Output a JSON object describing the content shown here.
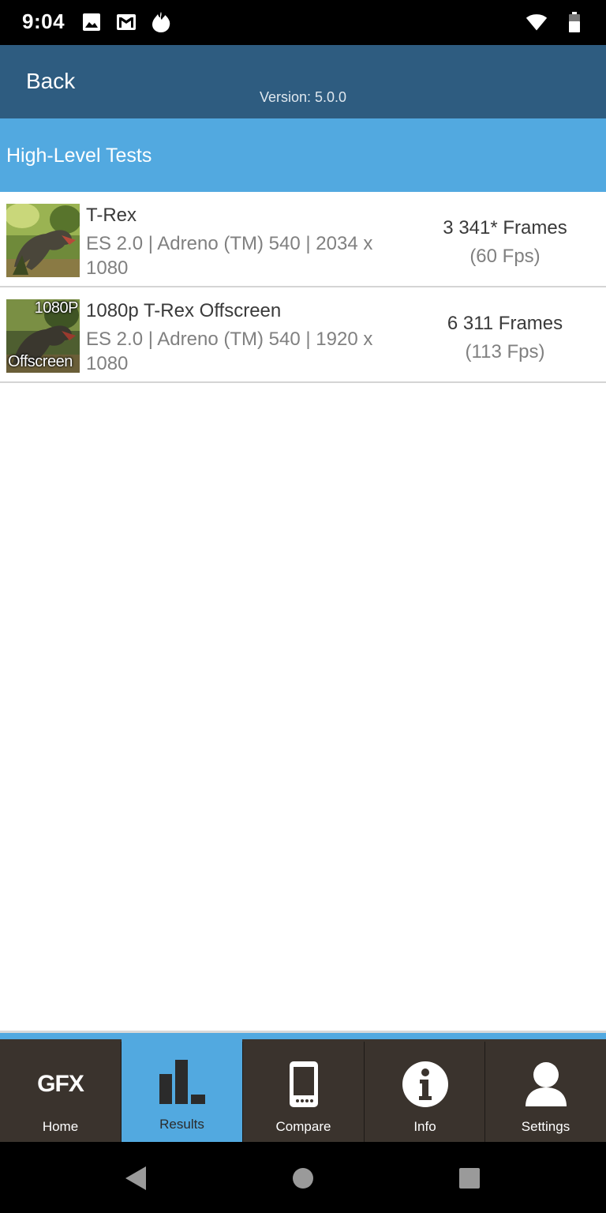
{
  "status_bar": {
    "time": "9:04",
    "left_icons": [
      "image-icon",
      "gmail-icon",
      "fire-icon"
    ],
    "right_icons": [
      "wifi-icon",
      "battery-icon"
    ]
  },
  "app_bar": {
    "back_label": "Back",
    "version": "Version: 5.0.0"
  },
  "section": {
    "title": "High-Level Tests"
  },
  "results": [
    {
      "name": "T-Rex",
      "details": "ES 2.0 | Adreno (TM) 540 | 2034 x 1080",
      "frames": "3 341* Frames",
      "fps": "(60 Fps)",
      "thumb_top_text": "",
      "thumb_bottom_text": ""
    },
    {
      "name": "1080p T-Rex Offscreen",
      "details": "ES 2.0 | Adreno (TM) 540 | 1920 x 1080",
      "frames": "6 311 Frames",
      "fps": "(113 Fps)",
      "thumb_top_text": "1080P",
      "thumb_bottom_text": "Offscreen"
    }
  ],
  "tabs": [
    {
      "label": "Home",
      "icon": "gfx-logo",
      "logo_text": "GFX",
      "active": false
    },
    {
      "label": "Results",
      "icon": "bar-chart-icon",
      "active": true
    },
    {
      "label": "Compare",
      "icon": "phone-icon",
      "active": false
    },
    {
      "label": "Info",
      "icon": "info-icon",
      "active": false
    },
    {
      "label": "Settings",
      "icon": "user-icon",
      "active": false
    }
  ],
  "colors": {
    "status_bar": "#000000",
    "app_bar": "#2e5c80",
    "accent": "#52a9e0",
    "tab_bar": "#3a332d"
  }
}
